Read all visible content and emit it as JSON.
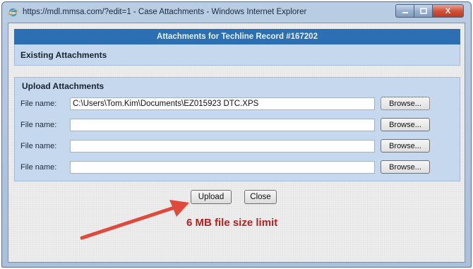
{
  "window": {
    "title": "https://mdl.mmsa.com/?edit=1 - Case Attachments - Windows Internet Explorer",
    "controls": {
      "minimize_icon": "minimize-icon",
      "maximize_icon": "maximize-icon",
      "close_label": "X"
    }
  },
  "dialog": {
    "header": "Attachments for Techline Record #167202",
    "existing_title": "Existing Attachments",
    "upload_title": "Upload Attachments",
    "rows": [
      {
        "label": "File name:",
        "value": "C:\\Users\\Tom.Kim\\Documents\\EZ015923 DTC.XPS",
        "browse": "Browse..."
      },
      {
        "label": "File name:",
        "value": "",
        "browse": "Browse..."
      },
      {
        "label": "File name:",
        "value": "",
        "browse": "Browse..."
      },
      {
        "label": "File name:",
        "value": "",
        "browse": "Browse..."
      }
    ],
    "upload_button": "Upload",
    "close_button": "Close"
  },
  "annotation": {
    "note": "6 MB file size limit",
    "color": "#b22222",
    "arrow_color": "#e04a3c"
  }
}
